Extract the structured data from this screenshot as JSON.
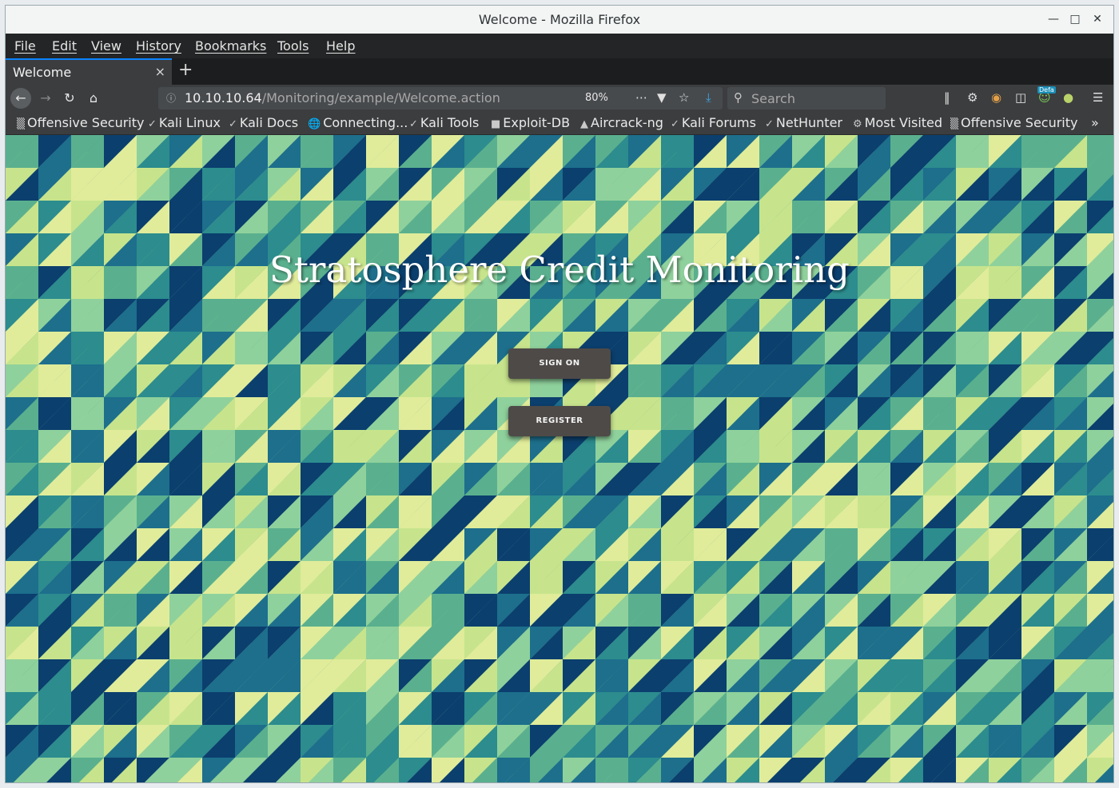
{
  "window": {
    "title": "Welcome - Mozilla Firefox"
  },
  "menu": [
    "File",
    "Edit",
    "View",
    "History",
    "Bookmarks",
    "Tools",
    "Help"
  ],
  "tab": {
    "label": "Welcome",
    "close": "×",
    "new_tab": "+"
  },
  "nav": {
    "url_host": "10.10.10.64",
    "url_path": "/Monitoring/example/Welcome.action",
    "zoom": "80%",
    "search_placeholder": "Search",
    "badge": "Defa"
  },
  "bookmarks": [
    {
      "label": "Offensive Security",
      "icon": "offsec-icon"
    },
    {
      "label": "Kali Linux",
      "icon": "kali-icon"
    },
    {
      "label": "Kali Docs",
      "icon": "kali-icon"
    },
    {
      "label": "Connecting...",
      "icon": "globe-icon"
    },
    {
      "label": "Kali Tools",
      "icon": "kali-icon"
    },
    {
      "label": "Exploit-DB",
      "icon": "exploitdb-icon"
    },
    {
      "label": "Aircrack-ng",
      "icon": "aircrack-icon"
    },
    {
      "label": "Kali Forums",
      "icon": "kali-icon"
    },
    {
      "label": "NetHunter",
      "icon": "kali-icon"
    },
    {
      "label": "Most Visited",
      "icon": "gear-icon"
    },
    {
      "label": "Offensive Security",
      "icon": "offsec-icon"
    }
  ],
  "page": {
    "heading": "Stratosphere Credit Monitoring",
    "sign_on": "SIGN ON",
    "register": "REGISTER"
  },
  "colors": {
    "tile_palette": [
      "#0b3f6e",
      "#1d6f8c",
      "#2c8c8e",
      "#5ab08e",
      "#8fd19c",
      "#c7e48c",
      "#e0ec9a"
    ],
    "button_bg": "#4e4a48"
  }
}
